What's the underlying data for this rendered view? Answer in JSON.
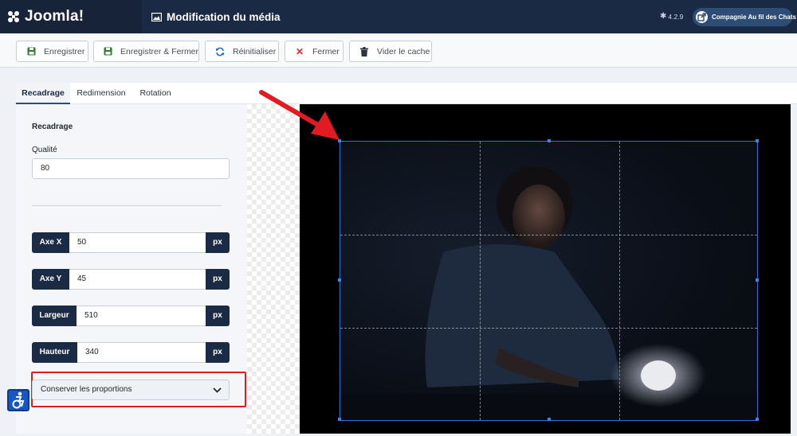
{
  "header": {
    "brand": "Joomla!",
    "page_title": "Modification du média",
    "version": "4.2.9",
    "site_button": "Compagnie Au fil des Chats"
  },
  "toolbar": {
    "save": "Enregistrer",
    "save_close": "Enregistrer & Fermer",
    "reset": "Réinitialiser",
    "close": "Fermer",
    "clear_cache": "Vider le cache"
  },
  "tabs": [
    "Recadrage",
    "Redimension",
    "Rotation"
  ],
  "crop_panel": {
    "title": "Recadrage",
    "quality_label": "Qualité",
    "quality_value": "80",
    "fields": [
      {
        "label": "Axe X",
        "value": "50",
        "unit": "px"
      },
      {
        "label": "Axe Y",
        "value": "45",
        "unit": "px"
      },
      {
        "label": "Largeur",
        "value": "510",
        "unit": "px"
      },
      {
        "label": "Hauteur",
        "value": "340",
        "unit": "px"
      }
    ],
    "ratio_selected": "Conserver les proportions"
  },
  "colors": {
    "header_bg": "#1b2a44",
    "brand_bg": "#172338",
    "accent": "#2c4d75",
    "annotation_red": "#e11b22",
    "crop_border": "#2d6fd6"
  },
  "icons": [
    "joomla-logo-icon",
    "image-icon",
    "joomla-version-icon",
    "external-link-icon",
    "save-icon",
    "sync-icon",
    "x-icon",
    "trash-icon",
    "chevron-down-icon",
    "accessibility-icon"
  ]
}
